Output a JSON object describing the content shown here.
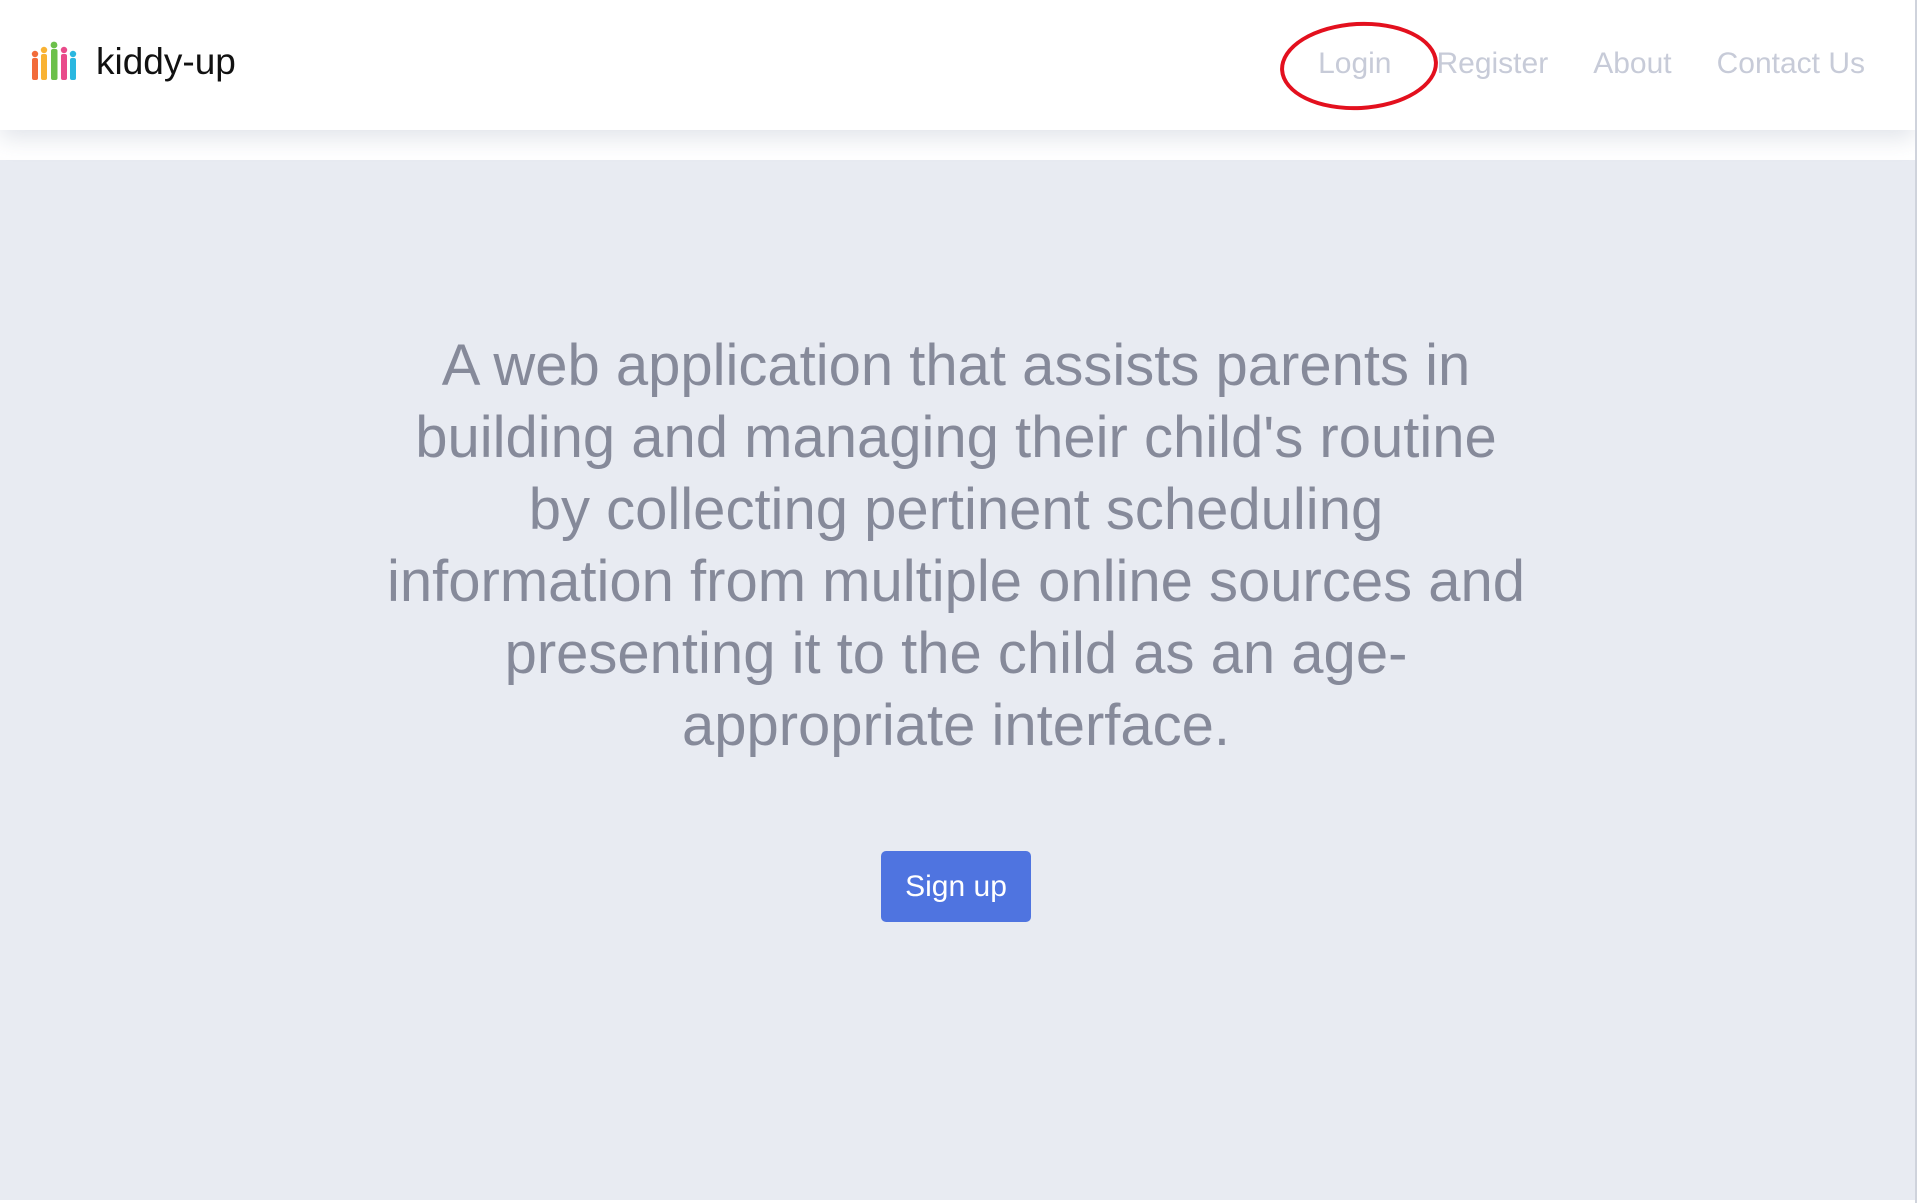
{
  "brand": {
    "name": "kiddy-up",
    "logo_icon": "family-people-logo",
    "logo_colors": [
      "#f26b3a",
      "#f9b233",
      "#6cc04a",
      "#e94b8a",
      "#2ab7e0"
    ]
  },
  "nav": {
    "items": [
      {
        "label": "Login",
        "highlighted": true
      },
      {
        "label": "Register"
      },
      {
        "label": "About"
      },
      {
        "label": "Contact Us"
      }
    ]
  },
  "hero": {
    "description": "A web application that assists parents in building and managing their child's routine by collecting pertinent scheduling information from multiple online sources and presenting it to the child as an age-appropriate interface.",
    "cta_label": "Sign up"
  },
  "colors": {
    "accent": "#4f74e0",
    "hero_background": "#e8ebf2",
    "nav_text": "#c7cbd8",
    "hero_text": "#868a9a",
    "highlight_ring": "#e3101e"
  }
}
